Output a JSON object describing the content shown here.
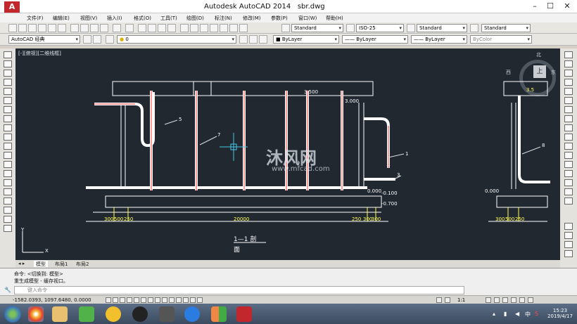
{
  "window": {
    "app_name": "Autodesk AutoCAD 2014",
    "file_name": "sbr.dwg",
    "logo": "A"
  },
  "menu": [
    "文件(F)",
    "编辑(E)",
    "视图(V)",
    "插入(I)",
    "格式(O)",
    "工具(T)",
    "绘图(D)",
    "标注(N)",
    "修改(M)",
    "参数(P)",
    "窗口(W)",
    "帮助(H)"
  ],
  "toolbar1": {
    "text_style": "Standard",
    "dim_style": "ISO-25",
    "table_style": "Standard",
    "mleader_style": "Standard"
  },
  "toolbar2": {
    "workspace": "AutoCAD 经典",
    "layer": "0",
    "color": "ByLayer",
    "linetype": "ByLayer",
    "lineweight": "ByLayer",
    "plotstyle": "ByColor"
  },
  "viewport": {
    "label": "[-][俯视][二维线框]",
    "compass": {
      "n": "北",
      "s": "",
      "e": "东",
      "w": "西",
      "top": "上"
    }
  },
  "drawing": {
    "elev_top": "3.500",
    "elev_mid": "3.000",
    "elev_ground": "0.000",
    "elev_100": "-0.100",
    "elev_700": "-0.700",
    "elev_right": "0.000",
    "elev_right_top": "3.5",
    "dims_left": [
      "300",
      "500",
      "250"
    ],
    "dim_main": "20000",
    "dims_right": [
      "250",
      "300",
      "300"
    ],
    "dims_right2": [
      "300",
      "500",
      "250"
    ],
    "leaders": [
      "5",
      "7",
      "1",
      "3",
      "8"
    ],
    "section_title": "1—1  剖",
    "section_sub": "面",
    "watermark_main": "沐风网",
    "watermark_url": "www.mfcad.com"
  },
  "layout_tabs": [
    "模型",
    "布局1",
    "布局2"
  ],
  "command": {
    "line1": "命令:  <切换到: 模型>",
    "line2": "重生成模型 - 缓存视口。",
    "prompt": "键入命令"
  },
  "status": {
    "coords": "-1582.0393, 1097.6480, 0.0000",
    "scale": "1:1"
  },
  "taskbar": {
    "time": "15:23",
    "date": "2019/4/17",
    "ime": "中"
  }
}
